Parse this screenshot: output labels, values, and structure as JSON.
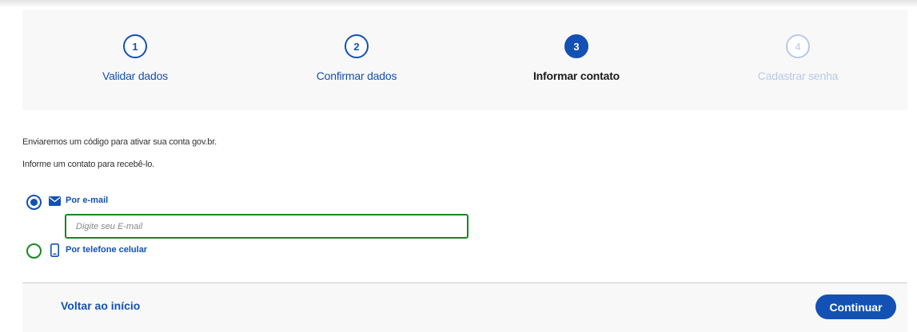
{
  "stepper": {
    "steps": [
      {
        "number": "1",
        "label": "Validar dados",
        "state": "done"
      },
      {
        "number": "2",
        "label": "Confirmar dados",
        "state": "done"
      },
      {
        "number": "3",
        "label": "Informar contato",
        "state": "active"
      },
      {
        "number": "4",
        "label": "Cadastrar senha",
        "state": "disabled"
      }
    ]
  },
  "info": {
    "line1": "Enviaremos um código para ativar sua conta gov.br.",
    "line2": "Informe um contato para recebê-lo."
  },
  "options": {
    "email": {
      "label": "Por e-mail",
      "selected": true,
      "icon": "envelope-icon"
    },
    "email_input": {
      "placeholder": "Digite seu E-mail",
      "value": ""
    },
    "phone": {
      "label": "Por telefone celular",
      "selected": false,
      "icon": "mobile-phone-icon"
    }
  },
  "footer": {
    "back_label": "Voltar ao início",
    "continue_label": "Continuar"
  },
  "colors": {
    "primary": "#1351b4",
    "success": "#168821",
    "disabled": "#b9c9e6",
    "panel": "#f8f8f8"
  }
}
